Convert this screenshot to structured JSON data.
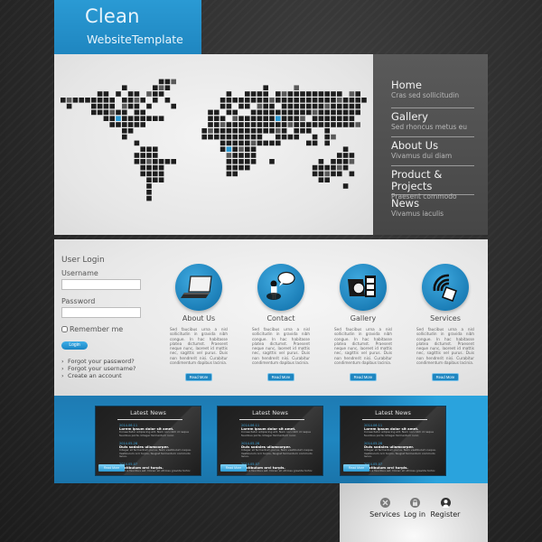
{
  "brand": {
    "title": "Clean",
    "subtitle": "WebsiteTemplate",
    "accent_color": "#1f86c0"
  },
  "nav": {
    "items": [
      {
        "label": "Home",
        "sub": "Cras sed sollicitudin"
      },
      {
        "label": "Gallery",
        "sub": "Sed rhoncus metus eu"
      },
      {
        "label": "About Us",
        "sub": "Vivamus dui diam"
      },
      {
        "label": "Product & Projects",
        "sub": "Praesent commodo"
      },
      {
        "label": "News",
        "sub": "Vivamus iaculis"
      }
    ]
  },
  "hero": {
    "image": "world-map-pixel-grid",
    "highlight_color": "#2a9ad4"
  },
  "login": {
    "title": "User Login",
    "username_label": "Username",
    "username_value": "",
    "password_label": "Password",
    "password_value": "",
    "remember_label": "Remember me",
    "remember_checked": false,
    "button_label": "Login",
    "links": [
      "Forgot your password?",
      "Forgot your username?",
      "Create an account"
    ]
  },
  "features": [
    {
      "title": "About Us",
      "icon": "laptop-icon",
      "text": "Sed faucibus urna a nisl sollicitudin in gravida nibh congue. In hac habitasse platea dictumst. Praesent neque nunc, laoreet id mattis nec, sagittis vel purus. Duis non hendrerit nisi. Curabitur condimentum dapibus lacinia.",
      "button": "Read More"
    },
    {
      "title": "Contact",
      "icon": "person-speech-bubble-icon",
      "text": "Sed faucibus urna a nisl sollicitudin in gravida nibh congue. In hac habitasse platea dictumst. Praesent neque nunc, laoreet id mattis nec, sagittis vel purus. Duis non hendrerit nisi. Curabitur condimentum dapibus lacinia.",
      "button": "Read More"
    },
    {
      "title": "Gallery",
      "icon": "camera-film-icon",
      "text": "Sed faucibus urna a nisl sollicitudin in gravida nibh congue. In hac habitasse platea dictumst. Praesent neque nunc, laoreet id mattis nec, sagittis vel purus. Duis non hendrerit nisi. Curabitur condimentum dapibus lacinia.",
      "button": "Read More"
    },
    {
      "title": "Services",
      "icon": "wireless-device-icon",
      "text": "Sed faucibus urna a nisl sollicitudin in gravida nibh congue. In hac habitasse platea dictumst. Praesent neque nunc, laoreet id mattis nec, sagittis vel purus. Duis non hendrerit nisi. Curabitur condimentum dapibus lacinia.",
      "button": "Read More"
    }
  ],
  "news_panels": [
    {
      "title": "Latest News",
      "items": [
        {
          "date": "2014.06.11",
          "head": "Lorem ipsum dolor sit amet.",
          "body": "Consectetur adipiscing elit. Nam non nibh id neque faucibus porta. Integer fermentum nunc."
        },
        {
          "date": "2014.05.28",
          "head": "Duis sodales ullamcorper.",
          "body": "Integer et fermentum purus. Nam vestibulum neque. Vestibulum orci turpis, feugiat fermentum commodo lacus."
        },
        {
          "date": "2014.05.07",
          "head": "Vestibulum orci turpis.",
          "body": "Proin a faucibus est. Donec et ultrices gravida tortor."
        }
      ],
      "button": "Read More"
    },
    {
      "title": "Latest News",
      "items": [
        {
          "date": "2014.06.11",
          "head": "Lorem ipsum dolor sit amet.",
          "body": "Consectetur adipiscing elit. Nam non nibh id neque faucibus porta. Integer fermentum nunc."
        },
        {
          "date": "2014.05.28",
          "head": "Duis sodales ullamcorper.",
          "body": "Integer et fermentum purus. Nam vestibulum neque. Vestibulum orci turpis, feugiat fermentum commodo lacus."
        },
        {
          "date": "2014.05.07",
          "head": "Vestibulum orci turpis.",
          "body": "Proin a faucibus est. Donec et ultrices gravida tortor."
        }
      ],
      "button": "Read More"
    },
    {
      "title": "Latest News",
      "items": [
        {
          "date": "2014.06.11",
          "head": "Lorem ipsum dolor sit amet.",
          "body": "Consectetur adipiscing elit. Nam non nibh id neque faucibus porta. Integer fermentum nunc."
        },
        {
          "date": "2014.05.28",
          "head": "Duis sodales ullamcorper.",
          "body": "Integer et fermentum purus. Nam vestibulum neque. Vestibulum orci turpis, feugiat fermentum commodo lacus."
        },
        {
          "date": "2014.05.07",
          "head": "Vestibulum orci turpis.",
          "body": "Proin a faucibus est. Donec et ultrices gravida tortor."
        }
      ],
      "button": "Read More"
    }
  ],
  "footer": {
    "items": [
      {
        "label": "Services",
        "icon": "services-icon"
      },
      {
        "label": "Log in",
        "icon": "lock-icon"
      },
      {
        "label": "Register",
        "icon": "user-icon"
      }
    ]
  }
}
